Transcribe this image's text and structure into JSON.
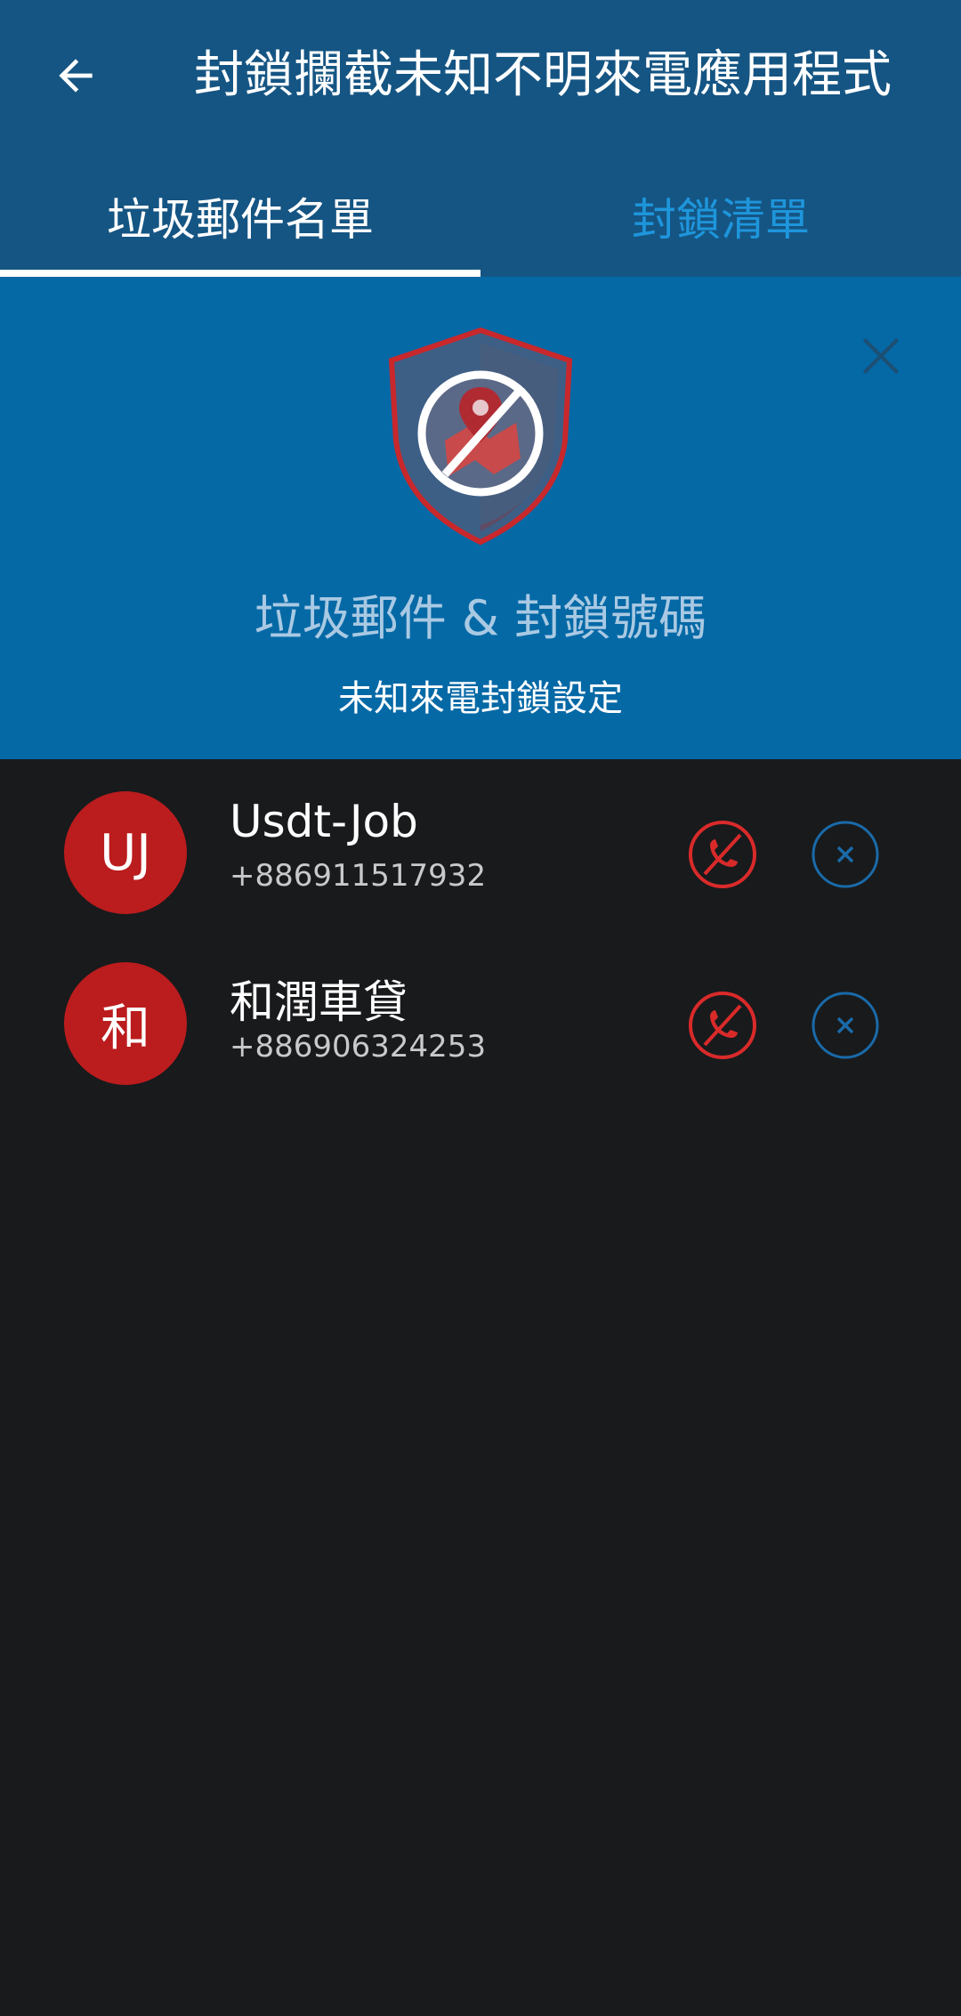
{
  "app_bar": {
    "title": "封鎖攔截未知不明來電應用程式",
    "back_icon": "arrow-left-icon"
  },
  "tabs": [
    {
      "label": "垃圾郵件名單",
      "active": true
    },
    {
      "label": "封鎖清單",
      "active": false
    }
  ],
  "banner": {
    "title": "垃圾郵件 & 封鎖號碼",
    "subtitle": "未知來電封鎖設定",
    "icon": "shield-block-location-icon",
    "close_icon": "close-icon"
  },
  "contacts": [
    {
      "initials": "UJ",
      "name": "Usdt-Job",
      "number": "+886911517932"
    },
    {
      "initials": "和",
      "name": "和潤車貸",
      "number": "+886906324253"
    }
  ],
  "colors": {
    "app_bar": "#155583",
    "banner": "#0569a6",
    "background": "#181a1c",
    "avatar": "#bb1c1d",
    "block_icon": "#d92a2a",
    "remove_icon": "#1a6aa8",
    "tab_inactive": "#1e96dc"
  }
}
